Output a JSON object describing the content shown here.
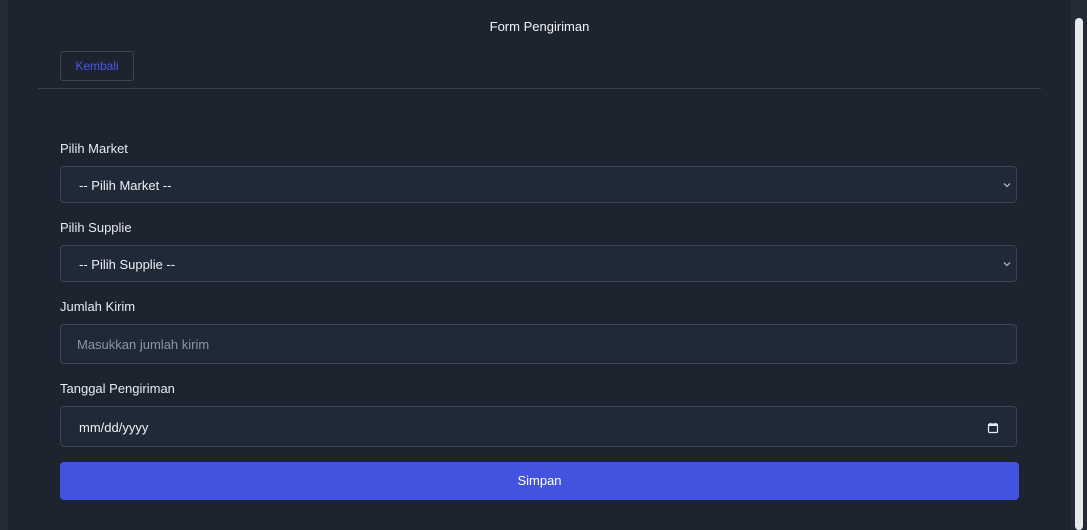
{
  "form": {
    "title": "Form Pengiriman",
    "back_label": "Kembali",
    "fields": [
      {
        "label": "Pilih Market",
        "value": "-- Pilih Market --"
      },
      {
        "label": "Pilih Supplie",
        "value": "-- Pilih Supplie --"
      },
      {
        "label": "Jumlah Kirim",
        "placeholder": "Masukkan jumlah kirim"
      },
      {
        "label": "Tanggal Pengiriman",
        "value": "mm/dd/yyyy"
      }
    ],
    "submit_label": "Simpan"
  },
  "colors": {
    "background": "#1d2430",
    "field_background": "#1f2937",
    "primary_button": "#4253df",
    "back_text": "#4b57e5"
  },
  "icons": {
    "select": "chevron-down-icon",
    "date": "calendar-icon"
  }
}
